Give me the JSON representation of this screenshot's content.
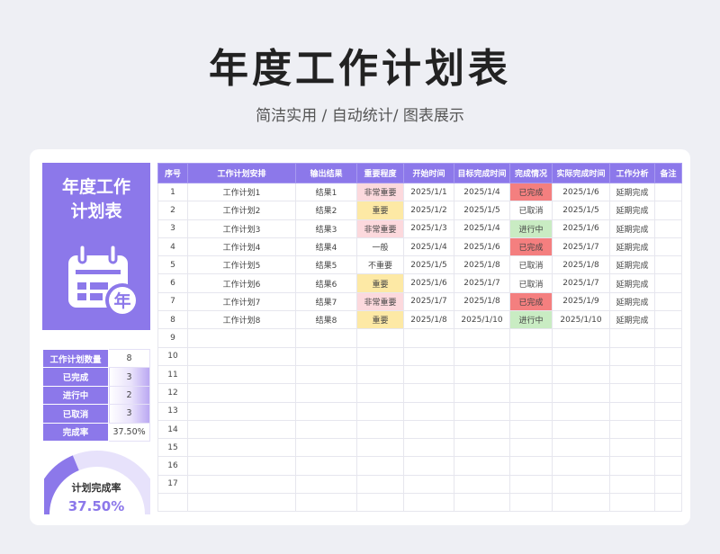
{
  "header": {
    "title": "年度工作计划表",
    "subtitle": "简洁实用 / 自动统计/ 图表展示"
  },
  "banner": {
    "title": "年度工作\n计划表",
    "icon": "calendar-icon",
    "badge_char": "年"
  },
  "stats": [
    {
      "label": "工作计划数量",
      "value": "8"
    },
    {
      "label": "已完成",
      "value": "3"
    },
    {
      "label": "进行中",
      "value": "2"
    },
    {
      "label": "已取消",
      "value": "3"
    },
    {
      "label": "完成率",
      "value": "37.50%"
    }
  ],
  "gauge": {
    "label": "计划完成率",
    "value": "37.50%",
    "fraction": 0.375
  },
  "colors": {
    "accent": "#8c78ea",
    "gauge_track": "#e7e2fb",
    "very_important": "#fcd9dd",
    "important": "#fde9a5",
    "done": "#f47f7f",
    "in_progress": "#c9ecc3"
  },
  "table": {
    "columns": [
      "序号",
      "工作计划安排",
      "输出结果",
      "重要程度",
      "开始时间",
      "目标完成时间",
      "完成情况",
      "实际完成时间",
      "工作分析",
      "备注"
    ],
    "rows": [
      {
        "no": "1",
        "plan": "工作计划1",
        "output": "结果1",
        "level": "非常重要",
        "start": "2025/1/1",
        "target": "2025/1/4",
        "status": "已完成",
        "actual": "2025/1/6",
        "analysis": "延期完成",
        "note": ""
      },
      {
        "no": "2",
        "plan": "工作计划2",
        "output": "结果2",
        "level": "重要",
        "start": "2025/1/2",
        "target": "2025/1/5",
        "status": "已取消",
        "actual": "2025/1/5",
        "analysis": "延期完成",
        "note": ""
      },
      {
        "no": "3",
        "plan": "工作计划3",
        "output": "结果3",
        "level": "非常重要",
        "start": "2025/1/3",
        "target": "2025/1/4",
        "status": "进行中",
        "actual": "2025/1/6",
        "analysis": "延期完成",
        "note": ""
      },
      {
        "no": "4",
        "plan": "工作计划4",
        "output": "结果4",
        "level": "一般",
        "start": "2025/1/4",
        "target": "2025/1/6",
        "status": "已完成",
        "actual": "2025/1/7",
        "analysis": "延期完成",
        "note": ""
      },
      {
        "no": "5",
        "plan": "工作计划5",
        "output": "结果5",
        "level": "不重要",
        "start": "2025/1/5",
        "target": "2025/1/8",
        "status": "已取消",
        "actual": "2025/1/8",
        "analysis": "延期完成",
        "note": ""
      },
      {
        "no": "6",
        "plan": "工作计划6",
        "output": "结果6",
        "level": "重要",
        "start": "2025/1/6",
        "target": "2025/1/7",
        "status": "已取消",
        "actual": "2025/1/7",
        "analysis": "延期完成",
        "note": ""
      },
      {
        "no": "7",
        "plan": "工作计划7",
        "output": "结果7",
        "level": "非常重要",
        "start": "2025/1/7",
        "target": "2025/1/8",
        "status": "已完成",
        "actual": "2025/1/9",
        "analysis": "延期完成",
        "note": ""
      },
      {
        "no": "8",
        "plan": "工作计划8",
        "output": "结果8",
        "level": "重要",
        "start": "2025/1/8",
        "target": "2025/1/10",
        "status": "进行中",
        "actual": "2025/1/10",
        "analysis": "延期完成",
        "note": ""
      },
      {
        "no": "9",
        "plan": "",
        "output": "",
        "level": "",
        "start": "",
        "target": "",
        "status": "",
        "actual": "",
        "analysis": "",
        "note": ""
      },
      {
        "no": "10",
        "plan": "",
        "output": "",
        "level": "",
        "start": "",
        "target": "",
        "status": "",
        "actual": "",
        "analysis": "",
        "note": ""
      },
      {
        "no": "11",
        "plan": "",
        "output": "",
        "level": "",
        "start": "",
        "target": "",
        "status": "",
        "actual": "",
        "analysis": "",
        "note": ""
      },
      {
        "no": "12",
        "plan": "",
        "output": "",
        "level": "",
        "start": "",
        "target": "",
        "status": "",
        "actual": "",
        "analysis": "",
        "note": ""
      },
      {
        "no": "13",
        "plan": "",
        "output": "",
        "level": "",
        "start": "",
        "target": "",
        "status": "",
        "actual": "",
        "analysis": "",
        "note": ""
      },
      {
        "no": "14",
        "plan": "",
        "output": "",
        "level": "",
        "start": "",
        "target": "",
        "status": "",
        "actual": "",
        "analysis": "",
        "note": ""
      },
      {
        "no": "15",
        "plan": "",
        "output": "",
        "level": "",
        "start": "",
        "target": "",
        "status": "",
        "actual": "",
        "analysis": "",
        "note": ""
      },
      {
        "no": "16",
        "plan": "",
        "output": "",
        "level": "",
        "start": "",
        "target": "",
        "status": "",
        "actual": "",
        "analysis": "",
        "note": ""
      },
      {
        "no": "17",
        "plan": "",
        "output": "",
        "level": "",
        "start": "",
        "target": "",
        "status": "",
        "actual": "",
        "analysis": "",
        "note": ""
      },
      {
        "no": "",
        "plan": "",
        "output": "",
        "level": "",
        "start": "",
        "target": "",
        "status": "",
        "actual": "",
        "analysis": "",
        "note": ""
      }
    ]
  }
}
